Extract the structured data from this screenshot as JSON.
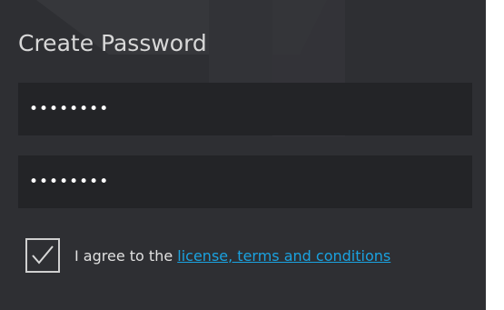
{
  "form": {
    "title": "Create Password",
    "password_mask": "••••••••",
    "confirm_password_mask": "••••••••",
    "agree_prefix": "I agree to the ",
    "agree_link": "license, terms and conditions",
    "agree_checked": true
  },
  "colors": {
    "panel_bg": "#2e2f33",
    "field_bg": "#232427",
    "title_text": "#d8d8d8",
    "link": "#1aa2e0"
  },
  "icons": {
    "checkbox": "checkmark-icon"
  }
}
